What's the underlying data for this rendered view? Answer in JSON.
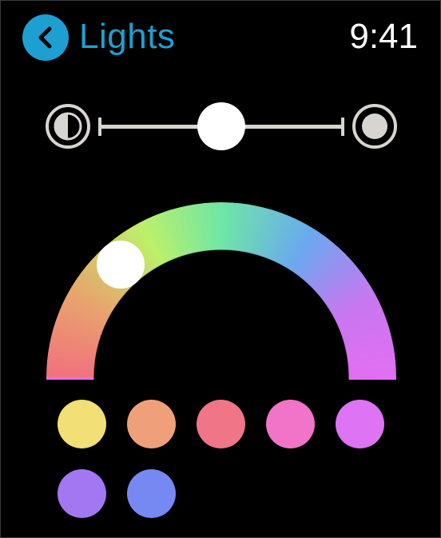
{
  "header": {
    "back_icon": "chevron-left-icon",
    "title": "Lights",
    "time": "9:41"
  },
  "colors": {
    "accent": "#1e9fd2",
    "control": "#d8d4d0",
    "thumb": "#ffffff"
  },
  "brightness": {
    "min_icon": "half-moon-dim-icon",
    "max_icon": "full-circle-bright-icon",
    "level": 0.5
  },
  "color_arc": {
    "gradient": [
      "#f2717d",
      "#e8a56d",
      "#bdf06a",
      "#6fe6a5",
      "#6aa9ef",
      "#c777f0",
      "#e26ff2"
    ],
    "selected": 0.18
  },
  "swatches": [
    {
      "name": "yellow",
      "color": "#f2df75"
    },
    {
      "name": "orange",
      "color": "#efa07a"
    },
    {
      "name": "coral",
      "color": "#f07587"
    },
    {
      "name": "pink",
      "color": "#f174c8"
    },
    {
      "name": "violet",
      "color": "#de73f3"
    },
    {
      "name": "purple",
      "color": "#a377f2"
    },
    {
      "name": "blue",
      "color": "#7689f2"
    }
  ]
}
